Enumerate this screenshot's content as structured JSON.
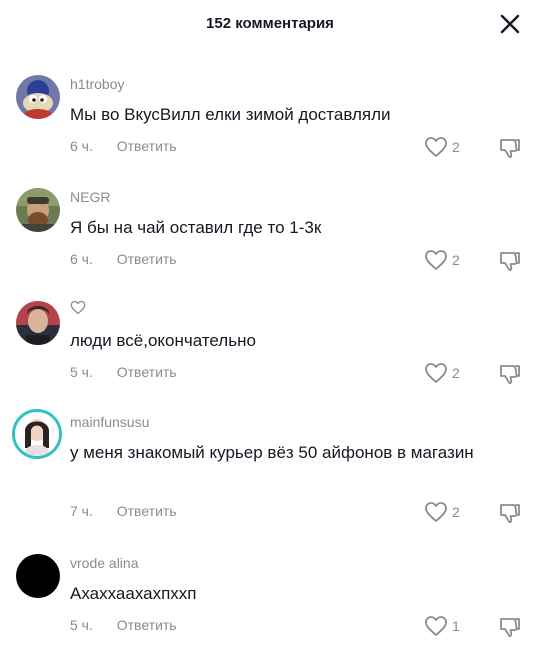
{
  "header": {
    "title": "152 комментария"
  },
  "icons": {
    "close": "close-icon",
    "like": "heart-outline-icon",
    "dislike": "thumbs-down-icon"
  },
  "colors": {
    "text": "#161823",
    "secondary": "#8a8b91",
    "avatar_ring": "#33c0c0"
  },
  "comments": [
    {
      "username": "h1troboy",
      "text": "Мы во ВкусВилл елки зимой доставляли",
      "time": "6 ч.",
      "reply_label": "Ответить",
      "likes": "2"
    },
    {
      "username": "NEGR",
      "text": "Я бы на чай оставил где то 1-3к",
      "time": "6 ч.",
      "reply_label": "Ответить",
      "likes": "2"
    },
    {
      "username": "",
      "text": "люди всё,окончательно",
      "time": "5 ч.",
      "reply_label": "Ответить",
      "likes": "2"
    },
    {
      "username": "mainfunsusu",
      "text": "у меня знакомый курьер вёз 50 айфонов в магазин",
      "time": "7 ч.",
      "reply_label": "Ответить",
      "likes": "2"
    },
    {
      "username": "vrode alina",
      "text": "Ахаххаахахпххп",
      "time": "5 ч.",
      "reply_label": "Ответить",
      "likes": "1"
    }
  ]
}
